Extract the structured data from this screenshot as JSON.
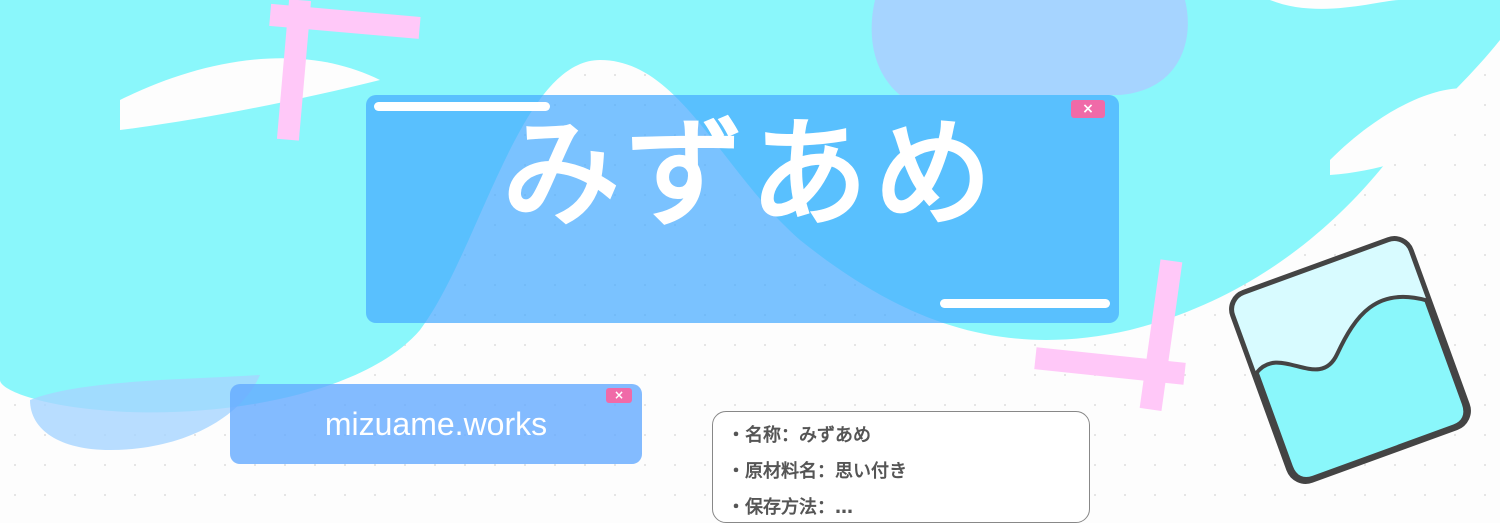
{
  "title": "みずあめ",
  "url": "mizuame.works",
  "close_icon": "×",
  "info": [
    "・名称：みずあめ",
    "・原材料名：思い付き",
    "・保存方法：…"
  ],
  "colors": {
    "cyan": "#8af7fb",
    "blue": "#46aaff",
    "pink": "#ffc8f8",
    "close": "#f06aa8"
  }
}
